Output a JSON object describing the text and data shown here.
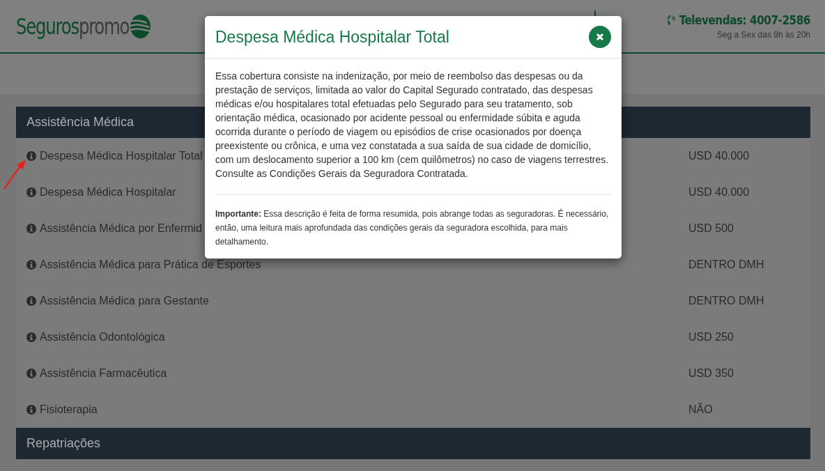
{
  "header": {
    "logo": {
      "primary": "Seguros",
      "secondary": "promo"
    },
    "contact": {
      "phone": "Televendas: 4007-2586",
      "hours": "Seg a Sex das 9h às 20h"
    }
  },
  "sections": [
    {
      "title": "Assistência Médica",
      "rows": [
        {
          "label": "Despesa Médica Hospitalar Total",
          "value": "USD 40.000"
        },
        {
          "label": "Despesa Médica Hospitalar",
          "value": "USD 40.000"
        },
        {
          "label": "Assistência Médica por Enfermid",
          "value": "USD 500"
        },
        {
          "label": "Assistência Médica para Prática de Esportes",
          "value": "DENTRO DMH"
        },
        {
          "label": "Assistência Médica para Gestante",
          "value": "DENTRO DMH"
        },
        {
          "label": "Assistência Odontológica",
          "value": "USD 250"
        },
        {
          "label": "Assistência Farmacêutica",
          "value": "USD 350"
        },
        {
          "label": "Fisioterapia",
          "value": "NÃO"
        }
      ]
    },
    {
      "title": "Repatriações"
    }
  ],
  "modal": {
    "title": "Despesa Médica Hospitalar Total",
    "body": "Essa cobertura consiste na indenização, por meio de reembolso das despesas ou da prestação de serviços, limitada ao valor do Capital Segurado contratado, das despesas médicas e/ou hospitalares total efetuadas pelo Segurado para seu tratamento, sob orientação médica, ocasionado por acidente pessoal ou enfermidade súbita e aguda ocorrida durante o período de viagem ou episódios de crise ocasionados por doença preexistente ou crônica, e uma vez constatada a sua saída de sua cidade de domicílio, com um deslocamento superior a 100 km (cem quilômetros) no caso de viagens terrestres. Consulte as Condições Gerais da Seguradora Contratada.",
    "note": "**Importante:** Essa descrição é feita de forma resumida, pois abrange todas as seguradoras. É necessário, então, uma leitura mais aprofundada das condições gerais da seguradora escolhida, para mais detalhamento."
  }
}
